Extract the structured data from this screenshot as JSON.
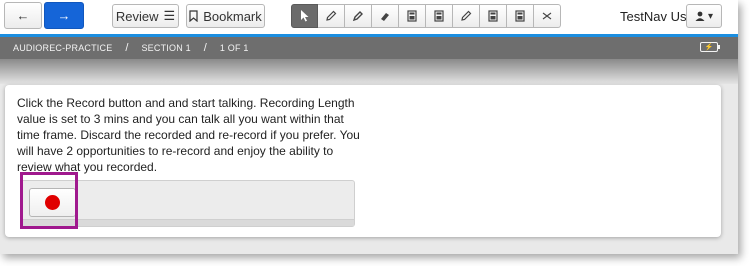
{
  "toolbar": {
    "review_label": "Review",
    "bookmark_label": "Bookmark",
    "user_name": "TestNav User",
    "tools": [
      "pointer",
      "pencil",
      "highlighter",
      "eraser",
      "calculator",
      "calculator",
      "pencil",
      "calculator",
      "calculator",
      "close"
    ]
  },
  "breadcrumb": {
    "test": "AUDIOREC-PRACTICE",
    "section": "SECTION 1",
    "position": "1 OF 1"
  },
  "question": {
    "text": "Click the Record button and and start talking. Recording Length value is set to 3 mins and you can talk all you want within that time frame. Discard the recorded and re-record if you prefer. You will have 2 opportunities to re-record and enjoy the ability to review what you recorded."
  },
  "colors": {
    "accent_blue": "#1565d8",
    "record_red": "#e00000",
    "highlight_purple": "#a0198e",
    "header_gray": "#6e6e6e"
  },
  "icons": {
    "back": "arrow-left-icon",
    "next": "arrow-right-icon",
    "review": "list-icon",
    "bookmark": "bookmark-icon",
    "user": "user-icon",
    "battery": "battery-icon"
  }
}
